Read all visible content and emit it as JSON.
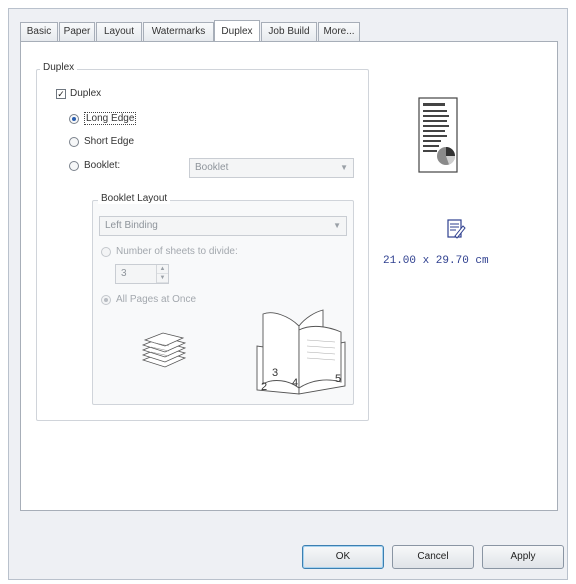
{
  "tabs": [
    {
      "label": "Basic"
    },
    {
      "label": "Paper"
    },
    {
      "label": "Layout"
    },
    {
      "label": "Watermarks"
    },
    {
      "label": "Duplex",
      "active": true
    },
    {
      "label": "Job Build"
    },
    {
      "label": "More..."
    }
  ],
  "duplex_group": {
    "title": "Duplex",
    "checkbox_label": "Duplex",
    "checked": true,
    "options": {
      "long_edge": "Long Edge",
      "short_edge": "Short Edge",
      "booklet": "Booklet:"
    },
    "selected_option": "long_edge",
    "booklet_select_value": "Booklet"
  },
  "booklet_layout": {
    "title": "Booklet Layout",
    "binding_value": "Left Binding",
    "number_of_sheets_label": "Number of sheets to divide:",
    "sheets_value": "3",
    "all_pages_label": "All Pages at Once"
  },
  "preview": {
    "page_size_text": "21.00 x 29.70 cm",
    "booklet_page_numbers": [
      "2",
      "3",
      "4",
      "5"
    ]
  },
  "buttons": {
    "ok": "OK",
    "cancel": "Cancel",
    "apply": "Apply"
  },
  "colors": {
    "accent": "#2b5fb0",
    "size_text": "#2e3f8f"
  }
}
